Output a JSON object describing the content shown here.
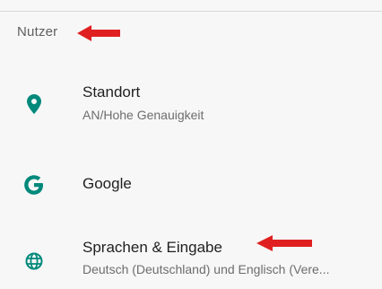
{
  "section": {
    "header": "Nutzer"
  },
  "items": [
    {
      "title": "Standort",
      "summary": "AN/Hohe Genauigkeit",
      "icon": "location-pin-icon"
    },
    {
      "title": "Google",
      "summary": "",
      "icon": "google-g-icon"
    },
    {
      "title": "Sprachen & Eingabe",
      "summary": "Deutsch (Deutschland) und Englisch (Vere...",
      "icon": "globe-icon"
    }
  ],
  "colors": {
    "accent": "#00897b",
    "annotation_arrow": "#e02020",
    "background": "#f7f7f7"
  }
}
